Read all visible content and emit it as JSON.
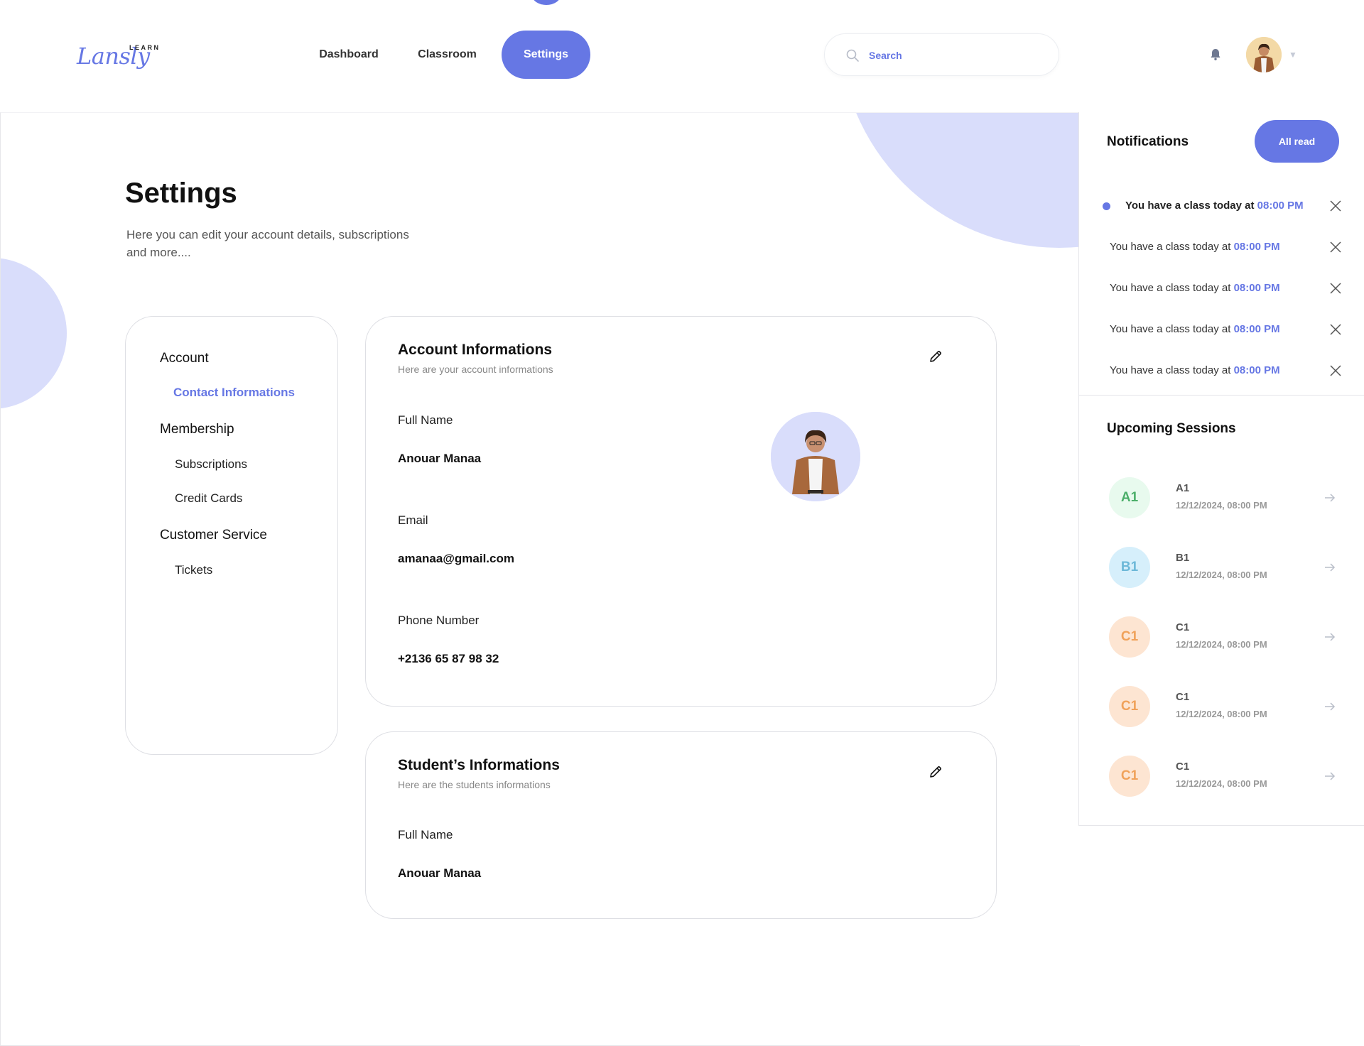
{
  "brand": {
    "logo_text": "Lansly",
    "logo_small": "LEARN"
  },
  "nav": {
    "dashboard": "Dashboard",
    "classroom": "Classroom",
    "settings": "Settings"
  },
  "search": {
    "placeholder": "Search"
  },
  "page": {
    "title": "Settings",
    "subtitle": "Here you can edit your account details, subscriptions and more...."
  },
  "menu": {
    "account": "Account",
    "contact_informations": "Contact Informations",
    "membership": "Membership",
    "subscriptions": "Subscriptions",
    "credit_cards": "Credit Cards",
    "customer_service": "Customer Service",
    "tickets": "Tickets"
  },
  "account_card": {
    "title": "Account Informations",
    "subtitle": "Here are your account informations",
    "full_name_label": "Full Name",
    "full_name": "Anouar Manaa",
    "email_label": "Email",
    "email": "amanaa@gmail.com",
    "phone_label": "Phone Number",
    "phone": "+2136 65 87 98 32"
  },
  "student_card": {
    "title": "Student’s Informations",
    "subtitle": "Here are the students informations",
    "full_name_label": "Full Name",
    "full_name": "Anouar Manaa"
  },
  "notifications": {
    "title": "Notifications",
    "all_read": "All read",
    "items": [
      {
        "text": "You have a class today at ",
        "time": "08:00 PM",
        "unread": true
      },
      {
        "text": "You have a class today at ",
        "time": "08:00 PM",
        "unread": false
      },
      {
        "text": "You have a class today at ",
        "time": "08:00 PM",
        "unread": false
      },
      {
        "text": "You have a class today at ",
        "time": "08:00 PM",
        "unread": false
      },
      {
        "text": "You have a class today at ",
        "time": "08:00 PM",
        "unread": false
      }
    ]
  },
  "sessions": {
    "title": "Upcoming Sessions",
    "items": [
      {
        "badge": "A1",
        "name": "A1",
        "date": "12/12/2024, 08:00 PM",
        "color": "#4caf6a",
        "bg": "#e8faee"
      },
      {
        "badge": "B1",
        "name": "B1",
        "date": "12/12/2024, 08:00 PM",
        "color": "#6cb8d8",
        "bg": "#d6effb"
      },
      {
        "badge": "C1",
        "name": "C1",
        "date": "12/12/2024, 08:00 PM",
        "color": "#f0a25a",
        "bg": "#fde5d2"
      },
      {
        "badge": "C1",
        "name": "C1",
        "date": "12/12/2024, 08:00 PM",
        "color": "#f0a25a",
        "bg": "#fde5d2"
      },
      {
        "badge": "C1",
        "name": "C1",
        "date": "12/12/2024, 08:00 PM",
        "color": "#f0a25a",
        "bg": "#fde5d2"
      }
    ]
  },
  "colors": {
    "accent": "#6677e4",
    "accent_light": "#d9ddfb"
  }
}
